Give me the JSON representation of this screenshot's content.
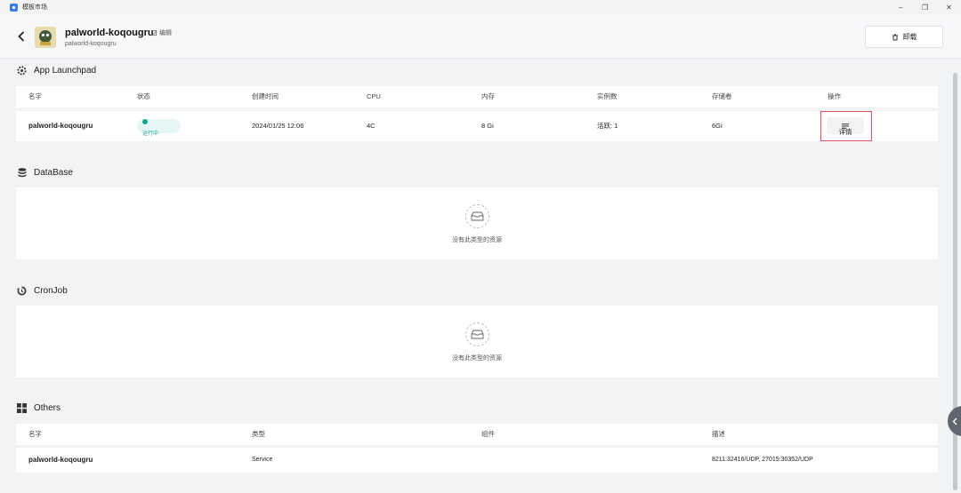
{
  "window": {
    "title": "模板市场",
    "controls": [
      "–",
      "❐",
      "✕"
    ]
  },
  "header": {
    "app_name": "palworld-koqougru",
    "app_subtitle": "palworld-koqougru",
    "edit_label": "编辑",
    "uninstall_label": "卸载"
  },
  "launchpad": {
    "title": "App Launchpad",
    "columns": [
      "名字",
      "状态",
      "创建时间",
      "CPU",
      "内存",
      "实例数",
      "存储卷",
      "操作"
    ],
    "row": {
      "name": "palworld-koqougru",
      "status": "运行中",
      "created": "2024/01/25 12:06",
      "cpu": "4C",
      "memory": "8 Gi",
      "replicas": "活跃: 1",
      "storage": "6Gi",
      "action_label": "详情"
    }
  },
  "database": {
    "title": "DataBase",
    "empty_text": "没有此类型的资源"
  },
  "cronjob": {
    "title": "CronJob",
    "empty_text": "没有此类型的资源"
  },
  "others": {
    "title": "Others",
    "columns": [
      "名字",
      "类型",
      "组件",
      "描述"
    ],
    "row": {
      "name": "palworld-koqougru",
      "type": "Service",
      "component": "",
      "description": "8211:32416/UDP, 27015:30352/UDP"
    }
  },
  "colors": {
    "accent": "#3b7cf0",
    "status_running": "#14a494",
    "highlight_border": "#e05260",
    "background": "#f2f3f5"
  }
}
